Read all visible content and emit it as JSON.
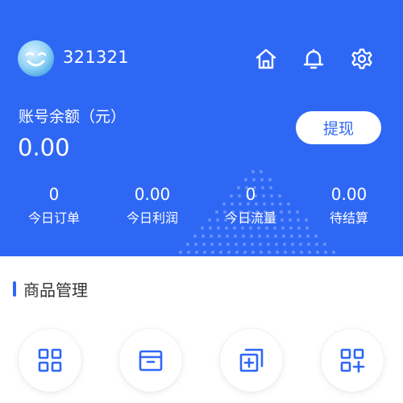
{
  "header": {
    "username": "321321",
    "icons": [
      "home-icon",
      "bell-icon",
      "gear-icon"
    ]
  },
  "account": {
    "balance_label": "账号余额（元）",
    "balance_value": "0.00",
    "withdraw_label": "提现"
  },
  "stats": [
    {
      "value": "0",
      "label": "今日订单"
    },
    {
      "value": "0.00",
      "label": "今日利润"
    },
    {
      "value": "0",
      "label": "今日流量"
    },
    {
      "value": "0.00",
      "label": "待结算"
    }
  ],
  "section": {
    "title": "商品管理"
  },
  "tools": [
    "grid-icon",
    "archive-box-icon",
    "add-square-icon",
    "grid-add-icon"
  ],
  "colors": {
    "brand": "#2f67f5",
    "white": "#ffffff",
    "text": "#333333"
  }
}
